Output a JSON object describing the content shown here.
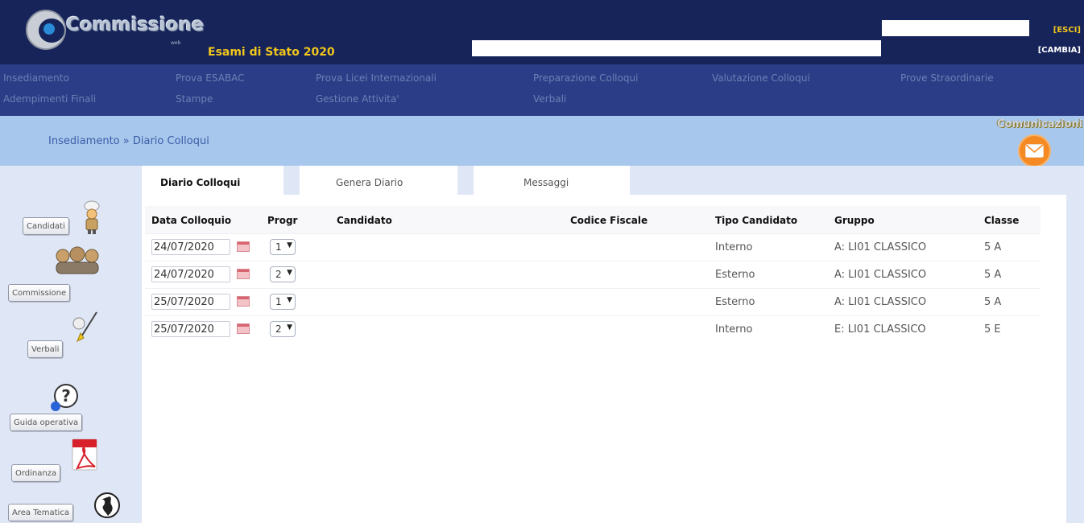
{
  "header": {
    "logo_text": "Commissione",
    "logo_subtext": "web",
    "title": "Esami di Stato 2020",
    "esci_label": "[ESCI]",
    "cambia_label": "[CAMBIA]"
  },
  "menu": {
    "items": [
      "Insediamento",
      "Prova ESABAC",
      "Prova Licei Internazionali",
      "Preparazione Colloqui",
      "Valutazione Colloqui",
      "Prove Straordinarie",
      "Adempimenti Finali",
      "Stampe",
      "Gestione Attivita'",
      "Verbali"
    ]
  },
  "breadcrumb": {
    "parent": "Insediamento",
    "separator": " » ",
    "current": "Diario Colloqui"
  },
  "comunicazioni_label": "Comunicazioni",
  "tabs": [
    {
      "label": "Diario Colloqui",
      "active": true
    },
    {
      "label": "Genera Diario",
      "active": false
    },
    {
      "label": "Messaggi",
      "active": false
    }
  ],
  "table": {
    "headers": [
      "Data Colloquio",
      "Progr",
      "Candidato",
      "Codice Fiscale",
      "Tipo Candidato",
      "Gruppo",
      "Classe"
    ],
    "rows": [
      {
        "date": "24/07/2020",
        "progr": "1",
        "candidato": "",
        "codice_fiscale": "",
        "tipo": "Interno",
        "gruppo": "A: LI01 CLASSICO",
        "classe": "5 A"
      },
      {
        "date": "24/07/2020",
        "progr": "2",
        "candidato": "",
        "codice_fiscale": "",
        "tipo": "Esterno",
        "gruppo": "A: LI01 CLASSICO",
        "classe": "5 A"
      },
      {
        "date": "25/07/2020",
        "progr": "1",
        "candidato": "",
        "codice_fiscale": "",
        "tipo": "Esterno",
        "gruppo": "A: LI01 CLASSICO",
        "classe": "5 A"
      },
      {
        "date": "25/07/2020",
        "progr": "2",
        "candidato": "",
        "codice_fiscale": "",
        "tipo": "Interno",
        "gruppo": "E: LI01 CLASSICO",
        "classe": "5 E"
      }
    ]
  },
  "sidebar": {
    "items": [
      {
        "label": "Candidati",
        "icon": "chef-figure-icon"
      },
      {
        "label": "Commissione",
        "icon": "group-figures-icon"
      },
      {
        "label": "Verbali",
        "icon": "pen-figure-icon"
      },
      {
        "label": "Guida operativa",
        "icon": "help-question-icon"
      },
      {
        "label": "Ordinanza",
        "icon": "pdf-document-icon"
      },
      {
        "label": "Area Tematica",
        "icon": "globe-icon"
      }
    ]
  },
  "colors": {
    "header_bg": "#16245a",
    "menu_bg": "#2a3d86",
    "menu_text": "#6c80b6",
    "accent_yellow": "#f2c61b",
    "crumb_band": "#a8c7ec",
    "body_bg": "#dfe6f6"
  }
}
